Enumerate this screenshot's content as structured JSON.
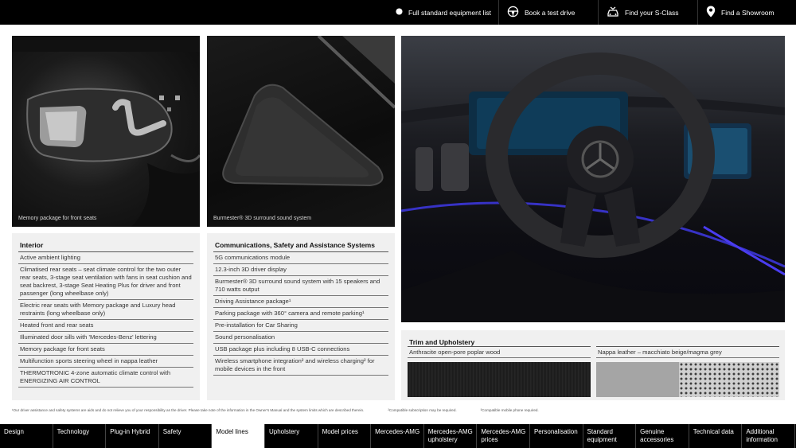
{
  "top_nav": {
    "items": [
      {
        "label": "Full standard equipment list",
        "icon": "circle-icon"
      },
      {
        "label": "Book a test drive",
        "icon": "steering-wheel-icon"
      },
      {
        "label": "Find your S-Class",
        "icon": "car-icon"
      },
      {
        "label": "Find a Showroom",
        "icon": "location-pin-icon"
      }
    ]
  },
  "images": {
    "memory_caption": "Memory package for front seats",
    "burmester_caption": "Burmester® 3D surround sound system"
  },
  "interior": {
    "title": "Interior",
    "items": [
      "Active ambient lighting",
      "Climatised rear seats – seat climate control for the two outer rear seats, 3-stage seat ventilation with fans in seat cushion and seat backrest, 3-stage Seat Heating Plus for driver and front passenger (long wheelbase only)",
      "Electric rear seats with Memory package and Luxury head restraints (long wheelbase only)",
      "Heated front and rear seats",
      "Illuminated door sills with 'Mercedes-Benz' lettering",
      "Memory package for front seats",
      "Multifunction sports steering wheel in nappa leather",
      "THERMOTRONIC 4-zone automatic climate control with ENERGIZING AIR CONTROL"
    ]
  },
  "comms": {
    "title": "Communications, Safety and Assistance Systems",
    "items": [
      "5G communications module",
      "12.3-inch 3D driver display",
      "Burmester® 3D surround sound system with 15 speakers and 710 watts output",
      "Driving Assistance package¹",
      "Parking package with 360° camera and remote parking¹",
      "Pre-installation for Car Sharing",
      "Sound personalisation",
      "USB package plus including 8 USB-C connections",
      "Wireless smartphone integration² and wireless charging² for mobile devices in the front"
    ]
  },
  "trim": {
    "title": "Trim and Upholstery",
    "items": [
      "Anthracite open-pore poplar wood",
      "Nappa leather – macchiato beige/magma grey"
    ]
  },
  "footnotes": [
    "¹Our driver assistance and safety systems are aids and do not relieve you of your responsibility as the driver. Please take note of the information in the Owner's Manual and the system limits which are described therein.",
    "²Compatible subscription may be required.",
    "³Compatible mobile phone required."
  ],
  "bottom_nav": {
    "items": [
      "Design",
      "Technology",
      "Plug-in Hybrid",
      "Safety",
      "Model lines",
      "Upholstery",
      "Model prices",
      "Mercedes-AMG",
      "Mercedes-AMG upholstery",
      "Mercedes-AMG prices",
      "Personalisation",
      "Standard equipment",
      "Genuine accessories",
      "Technical data",
      "Additional information"
    ],
    "active": "Model lines"
  }
}
